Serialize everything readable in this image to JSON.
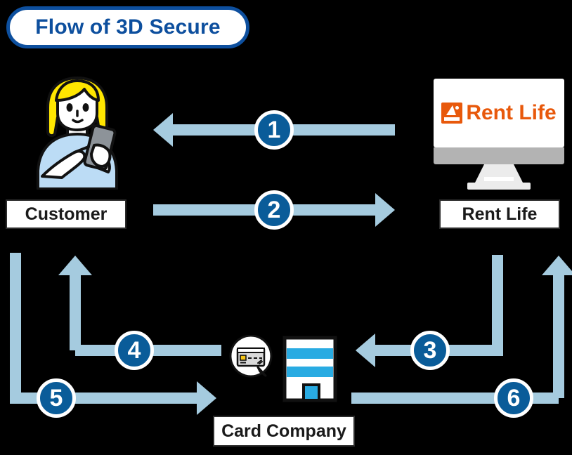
{
  "title": {
    "text": "Flow of 3D Secure"
  },
  "colors": {
    "title_blue": "#0d4f9e",
    "arrow_blue": "#a5cbdf",
    "circle_blue": "#0a5c99",
    "brand_orange": "#e8590c",
    "building_blue": "#29abe2",
    "background": "#000000"
  },
  "actors": {
    "customer": {
      "label": "Customer",
      "icon": "person-with-smartphone-icon"
    },
    "merchant": {
      "label": "Rent Life",
      "icon": "desktop-monitor-icon",
      "screen_logo_text": "Rent Life"
    },
    "card_company": {
      "label": "Card Company",
      "icon": "office-building-icon",
      "bubble_icon": "credit-card-icon"
    }
  },
  "steps": [
    {
      "number": "1",
      "from": "Rent Life",
      "to": "Customer",
      "direction": "left"
    },
    {
      "number": "2",
      "from": "Customer",
      "to": "Rent Life",
      "direction": "right"
    },
    {
      "number": "3",
      "from": "Rent Life",
      "to": "Card Company",
      "direction": "down-left"
    },
    {
      "number": "4",
      "from": "Card Company",
      "to": "Customer",
      "direction": "left-up"
    },
    {
      "number": "5",
      "from": "Customer",
      "to": "Card Company",
      "direction": "down-right"
    },
    {
      "number": "6",
      "from": "Card Company",
      "to": "Rent Life",
      "direction": "right-up"
    }
  ]
}
